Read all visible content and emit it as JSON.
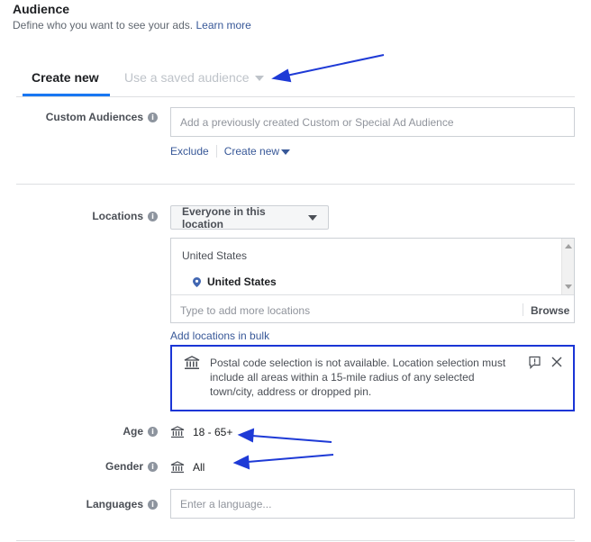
{
  "header": {
    "title": "Audience",
    "subtitle": "Define who you want to see your ads.",
    "learn_more": "Learn more"
  },
  "tabs": {
    "create_new": "Create new",
    "saved_audience": "Use a saved audience"
  },
  "custom_audiences": {
    "label": "Custom Audiences",
    "placeholder": "Add a previously created Custom or Special Ad Audience",
    "exclude": "Exclude",
    "create_new": "Create new"
  },
  "locations": {
    "label": "Locations",
    "dropdown": "Everyone in this location",
    "country_header": "United States",
    "selected": "United States",
    "add_placeholder": "Type to add more locations",
    "browse": "Browse",
    "add_bulk": "Add locations in bulk"
  },
  "notice": {
    "text": "Postal code selection is not available. Location selection must include all areas within a 15-mile radius of any selected town/city, address or dropped pin."
  },
  "age": {
    "label": "Age",
    "value": "18 - 65+"
  },
  "gender": {
    "label": "Gender",
    "value": "All"
  },
  "languages": {
    "label": "Languages",
    "placeholder": "Enter a language..."
  },
  "colors": {
    "link": "#385898",
    "annotation": "#1e3ad6",
    "tab_accent": "#1877f2"
  }
}
